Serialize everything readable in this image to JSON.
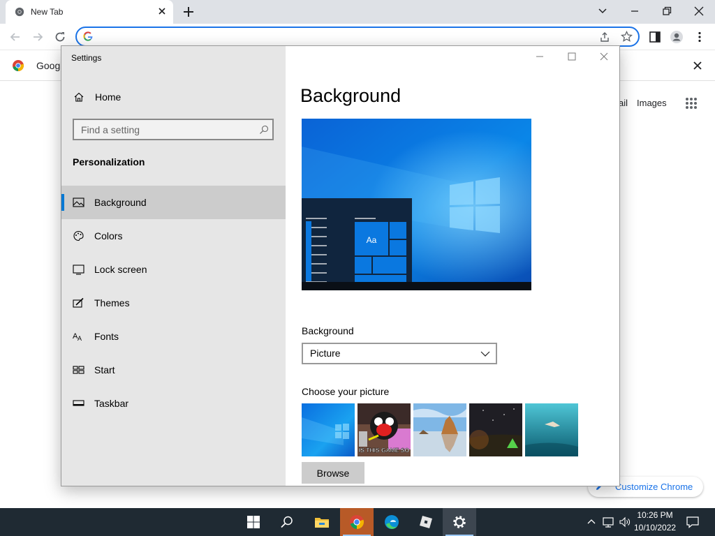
{
  "browser": {
    "tab_title": "New Tab",
    "omnibox_value": "",
    "bookmark_label": "Googl",
    "ntp": {
      "gmail": "ail",
      "images": "Images",
      "customize": "Customize Chrome"
    }
  },
  "settings": {
    "window_title": "Settings",
    "home": "Home",
    "search_placeholder": "Find a setting",
    "section": "Personalization",
    "nav": [
      {
        "label": "Background",
        "icon": "picture-icon",
        "selected": true
      },
      {
        "label": "Colors",
        "icon": "palette-icon"
      },
      {
        "label": "Lock screen",
        "icon": "lock-screen-icon"
      },
      {
        "label": "Themes",
        "icon": "themes-icon"
      },
      {
        "label": "Fonts",
        "icon": "fonts-icon"
      },
      {
        "label": "Start",
        "icon": "start-icon"
      },
      {
        "label": "Taskbar",
        "icon": "taskbar-icon"
      }
    ],
    "page_title": "Background",
    "preview_tile_text": "Aa",
    "background_label": "Background",
    "background_value": "Picture",
    "choose_label": "Choose your picture",
    "thumbnail_caption": "IS THIS GAME SO",
    "browse_label": "Browse"
  },
  "taskbar": {
    "time": "10:26 PM",
    "date": "10/10/2022",
    "apps": [
      "start-icon",
      "search-icon",
      "file-explorer-icon",
      "chrome-icon",
      "edge-icon",
      "roblox-icon",
      "settings-icon"
    ]
  },
  "colors": {
    "accent": "#0078d4",
    "chrome_blue": "#1a73e8",
    "sidebar_bg": "#e6e6e6",
    "taskbar_bg": "#1f2a33"
  }
}
